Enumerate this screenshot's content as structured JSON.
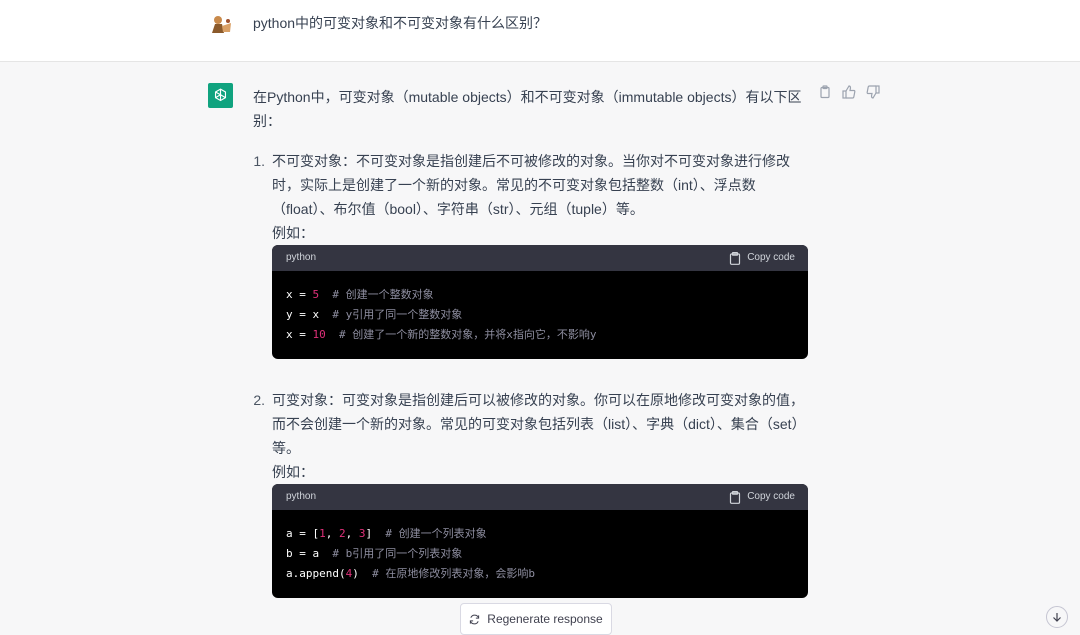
{
  "user_message": "python中的可变对象和不可变对象有什么区别？",
  "assistant": {
    "intro": "在Python中，可变对象（mutable objects）和不可变对象（immutable objects）有以下区别：",
    "items": [
      {
        "number": "1.",
        "text": "不可变对象：不可变对象是指创建后不可被修改的对象。当你对不可变对象进行修改时，实际上是创建了一个新的对象。常见的不可变对象包括整数（int）、浮点数（float）、布尔值（bool）、字符串（str）、元组（tuple）等。",
        "example_label": "例如：",
        "code_lang": "python",
        "copy_label": "Copy code"
      },
      {
        "number": "2.",
        "text": "可变对象：可变对象是指创建后可以被修改的对象。你可以在原地修改可变对象的值，而不会创建一个新的对象。常见的可变对象包括列表（list）、字典（dict）、集合（set）等。",
        "example_label": "例如：",
        "code_lang": "python",
        "copy_label": "Copy code"
      }
    ]
  },
  "code1": {
    "l1_code": "x = ",
    "l1_num": "5",
    "l1_comment": "  # 创建一个整数对象",
    "l2_code": "y = x  ",
    "l2_comment": "# y引用了同一个整数对象",
    "l3_code": "x = ",
    "l3_num": "10",
    "l3_comment": "  # 创建了一个新的整数对象，并将x指向它，不影响y"
  },
  "code2": {
    "l1_a": "a = [",
    "l1_n1": "1",
    "l1_b": ", ",
    "l1_n2": "2",
    "l1_c": ", ",
    "l1_n3": "3",
    "l1_d": "]  ",
    "l1_comment": "# 创建一个列表对象",
    "l2_code": "b = a  ",
    "l2_comment": "# b引用了同一个列表对象",
    "l3_a": "a.append(",
    "l3_n": "4",
    "l3_b": ")  ",
    "l3_comment": "# 在原地修改列表对象，会影响b"
  },
  "footer": {
    "regenerate_label": "Regenerate response"
  },
  "colors": {
    "accent_green": "#10a37f",
    "code_number": "#df3079",
    "code_comment": "#8e8ea0"
  },
  "icons": [
    "user-avatar-icon",
    "openai-logo-icon",
    "copy-icon",
    "thumbs-up-icon",
    "thumbs-down-icon",
    "clipboard-icon",
    "refresh-icon",
    "arrow-down-icon"
  ]
}
